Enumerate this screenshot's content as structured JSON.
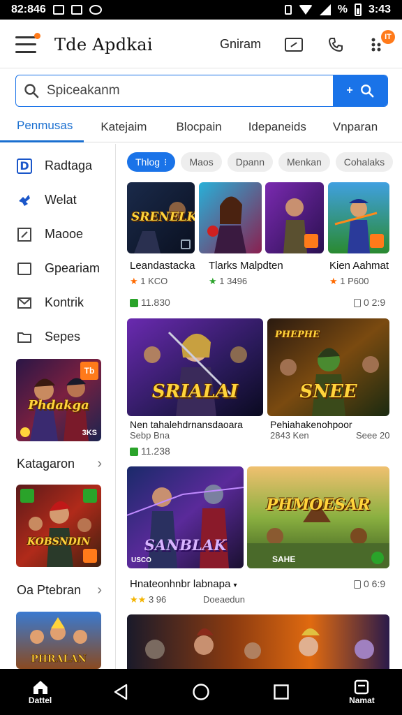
{
  "status_bar": {
    "time_left": "82:846",
    "time_right": "3:43",
    "battery_text": "%"
  },
  "app_bar": {
    "title": "Tde Apdkai",
    "action_text": "Gniram",
    "badge": "IT"
  },
  "search": {
    "placeholder": "Spiceakanm"
  },
  "tabs": [
    "Penmusas",
    "Katejaim",
    "Blocpain",
    "Idepaneids",
    "Vnparan"
  ],
  "sidebar": {
    "items": [
      {
        "label": "Radtaga",
        "icon": "d-logo-icon"
      },
      {
        "label": "Welat",
        "icon": "puzzle-icon"
      },
      {
        "label": "Maooe",
        "icon": "edit-icon"
      },
      {
        "label": "Gpeariam",
        "icon": "square-icon"
      },
      {
        "label": "Kontrik",
        "icon": "mail-icon"
      },
      {
        "label": "Sepes",
        "icon": "folder-icon"
      }
    ],
    "promo1": {
      "art": "Phdakga",
      "badge": "Tb",
      "tag": "3KS"
    },
    "section1": "Katagaron",
    "promo2": {
      "art": "KOBSNDIN"
    },
    "section2": "Oa Ptebran"
  },
  "chips": [
    "Thlog",
    "Maos",
    "Dpann",
    "Menkan",
    "Cohalaks"
  ],
  "grid_row1": [
    {
      "title": "Leandastacka",
      "rating": "1 KCO",
      "art": "SRENELK"
    },
    {
      "title": "Tlarks Malpdten",
      "rating": "1 3496",
      "art": ""
    },
    {
      "title": "Kien Aahmat",
      "rating": "1 P600",
      "art": ""
    }
  ],
  "row1_meta": {
    "left": "11.830",
    "right": "0 2:9"
  },
  "feature1": {
    "art_left": "SRIALAI",
    "art_right": "SNEE",
    "top_right_art": "PHEPHE",
    "title_left": "Nen tahalehdrnansdaoara",
    "title_right": "Pehiahakenohpoor",
    "sub_left": "Sebp Bna",
    "sub_right": "Seee 20",
    "tiny_left": "2843 Ken",
    "meta": "11.238"
  },
  "feature2": {
    "art_left": "SANBLAK",
    "art_right": "PHMOESAR",
    "tag_left": "USCO",
    "tag_right": "SAHE",
    "title": "Hnateonhnbr labnapa",
    "rating": "3 96",
    "sub": "Doeaedun",
    "right": "0 6:9"
  },
  "navbar": {
    "home_label": "Dattel",
    "right_label": "Namat"
  }
}
